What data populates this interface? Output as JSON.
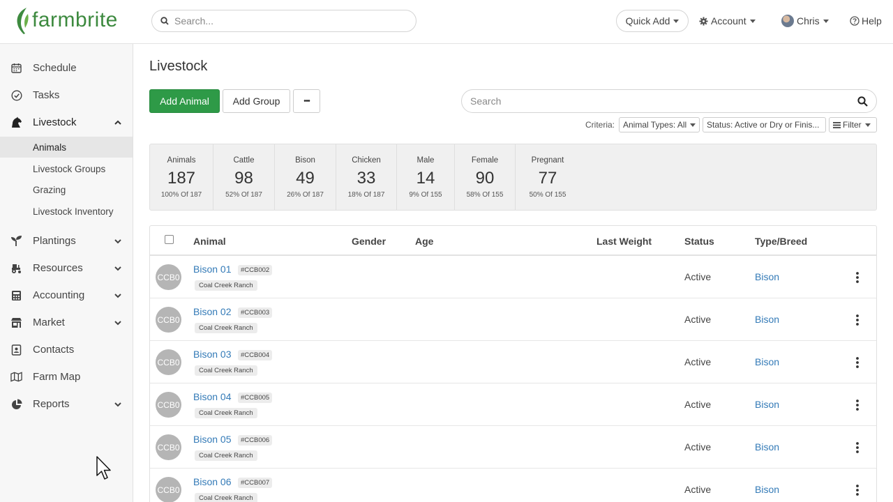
{
  "brand": {
    "name": "farmbrite",
    "color": "#3d8a3f"
  },
  "header": {
    "search_placeholder": "Search...",
    "quick_add": "Quick Add",
    "account": "Account",
    "user": "Chris",
    "help": "Help"
  },
  "sidebar": {
    "items": [
      {
        "label": "Schedule",
        "icon": "calendar-icon"
      },
      {
        "label": "Tasks",
        "icon": "check-circle-icon"
      },
      {
        "label": "Livestock",
        "icon": "horse-icon",
        "expanded": true
      },
      {
        "label": "Plantings",
        "icon": "seedling-icon"
      },
      {
        "label": "Resources",
        "icon": "tractor-icon"
      },
      {
        "label": "Accounting",
        "icon": "calculator-icon"
      },
      {
        "label": "Market",
        "icon": "store-icon"
      },
      {
        "label": "Contacts",
        "icon": "address-book-icon"
      },
      {
        "label": "Farm Map",
        "icon": "map-icon"
      },
      {
        "label": "Reports",
        "icon": "pie-chart-icon"
      }
    ],
    "livestock_sub": [
      "Animals",
      "Livestock Groups",
      "Grazing",
      "Livestock Inventory"
    ],
    "selected_sub": "Animals"
  },
  "main": {
    "title": "Livestock",
    "add_animal": "Add Animal",
    "add_group": "Add Group",
    "more": "•••",
    "search_placeholder": "Search",
    "criteria_label": "Criteria:",
    "criteria_types": "Animal Types: All",
    "criteria_status": "Status: Active or Dry or Finis...",
    "filter": "Filter"
  },
  "stats": [
    {
      "label": "Animals",
      "value": "187",
      "sub": "100% Of 187"
    },
    {
      "label": "Cattle",
      "value": "98",
      "sub": "52% Of 187"
    },
    {
      "label": "Bison",
      "value": "49",
      "sub": "26% Of 187"
    },
    {
      "label": "Chicken",
      "value": "33",
      "sub": "18% Of 187"
    },
    {
      "label": "Male",
      "value": "14",
      "sub": "9% Of 155"
    },
    {
      "label": "Female",
      "value": "90",
      "sub": "58% Of 155"
    },
    {
      "label": "Pregnant",
      "value": "77",
      "sub": "50% Of 155"
    }
  ],
  "table": {
    "columns": [
      "Animal",
      "Gender",
      "Age",
      "Last Weight",
      "Status",
      "Type/Breed"
    ],
    "rows": [
      {
        "avatar": "CCB0",
        "name": "Bison 01",
        "tag": "#CCB002",
        "location": "Coal Creek Ranch",
        "status": "Active",
        "breed": "Bison"
      },
      {
        "avatar": "CCB0",
        "name": "Bison 02",
        "tag": "#CCB003",
        "location": "Coal Creek Ranch",
        "status": "Active",
        "breed": "Bison"
      },
      {
        "avatar": "CCB0",
        "name": "Bison 03",
        "tag": "#CCB004",
        "location": "Coal Creek Ranch",
        "status": "Active",
        "breed": "Bison"
      },
      {
        "avatar": "CCB0",
        "name": "Bison 04",
        "tag": "#CCB005",
        "location": "Coal Creek Ranch",
        "status": "Active",
        "breed": "Bison"
      },
      {
        "avatar": "CCB0",
        "name": "Bison 05",
        "tag": "#CCB006",
        "location": "Coal Creek Ranch",
        "status": "Active",
        "breed": "Bison"
      },
      {
        "avatar": "CCB0",
        "name": "Bison 06",
        "tag": "#CCB007",
        "location": "Coal Creek Ranch",
        "status": "Active",
        "breed": "Bison"
      }
    ]
  },
  "colors": {
    "accent_green": "#2e9a47",
    "link_blue": "#337ab7"
  }
}
